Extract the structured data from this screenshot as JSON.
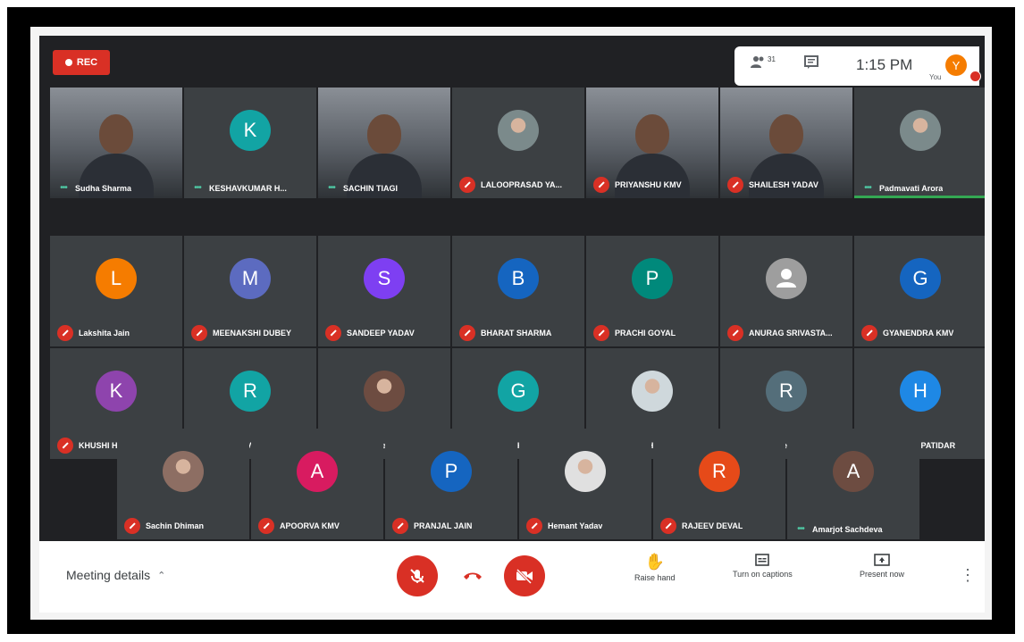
{
  "recording": {
    "label": "REC"
  },
  "top_bar": {
    "people_count": "31",
    "time": "1:15 PM",
    "self_initial": "Y",
    "self_label": "You"
  },
  "participants_row1": [
    {
      "name": "Sudha Sharma",
      "kind": "video",
      "status": "speaking"
    },
    {
      "name": "KESHAVKUMAR H...",
      "kind": "avatar",
      "initial": "K",
      "color": "#12a4a4",
      "status": "speaking"
    },
    {
      "name": "SACHIN TIAGI",
      "kind": "video",
      "status": "speaking"
    },
    {
      "name": "LALOOPRASAD YA...",
      "kind": "photo",
      "status": "muted"
    },
    {
      "name": "PRIYANSHU KMV",
      "kind": "video",
      "status": "muted"
    },
    {
      "name": "SHAILESH YADAV",
      "kind": "video",
      "status": "muted"
    },
    {
      "name": "Padmavati Arora",
      "kind": "photo",
      "status": "speaking"
    }
  ],
  "participants_row2": [
    {
      "name": "Lakshita Jain",
      "initial": "L",
      "color": "#f57c00"
    },
    {
      "name": "MEENAKSHI DUBEY",
      "initial": "M",
      "color": "#5c6bc0"
    },
    {
      "name": "SANDEEP YADAV",
      "initial": "S",
      "color": "#7e3ff2"
    },
    {
      "name": "BHARAT SHARMA",
      "initial": "B",
      "color": "#1565c0"
    },
    {
      "name": "PRACHI GOYAL",
      "initial": "P",
      "color": "#00897b"
    },
    {
      "name": "ANURAG SRIVASTA...",
      "initial": "",
      "color": "#9e9e9e"
    },
    {
      "name": "GYANENDRA KMV",
      "initial": "G",
      "color": "#1565c0"
    }
  ],
  "participants_row3": [
    {
      "name": "KHUSHI HAL",
      "initial": "K",
      "color": "#8e44ad"
    },
    {
      "name": "RITU KMV",
      "initial": "R",
      "color": "#12a4a4"
    },
    {
      "name": "Bhupender",
      "initial": "",
      "color": "#6d4c41"
    },
    {
      "name": "GAURAV KMV",
      "initial": "G",
      "color": "#12a4a4"
    },
    {
      "name": "BHAVESH YADAV",
      "initial": "",
      "color": "#cfd8dc"
    },
    {
      "name": "Raghuveer Singh R...",
      "initial": "R",
      "color": "#546e7a"
    },
    {
      "name": "HARSHIT PATIDAR",
      "initial": "H",
      "color": "#1e88e5"
    }
  ],
  "participants_row4": [
    {
      "name": "Sachin Dhiman",
      "initial": "",
      "color": "#8d6e63",
      "status": "muted"
    },
    {
      "name": "APOORVA KMV",
      "initial": "A",
      "color": "#d81b60",
      "status": "muted"
    },
    {
      "name": "PRANJAL JAIN",
      "initial": "P",
      "color": "#1565c0",
      "status": "muted"
    },
    {
      "name": "Hemant Yadav",
      "initial": "",
      "color": "#e0e0e0",
      "status": "muted"
    },
    {
      "name": "RAJEEV DEVAL",
      "initial": "R",
      "color": "#e64a19",
      "status": "muted"
    },
    {
      "name": "Amarjot Sachdeva",
      "initial": "A",
      "color": "#6d4c41",
      "status": "speaking"
    }
  ],
  "bottom_bar": {
    "meeting_details": "Meeting details",
    "raise_hand": "Raise hand",
    "captions": "Turn on captions",
    "present": "Present now"
  }
}
